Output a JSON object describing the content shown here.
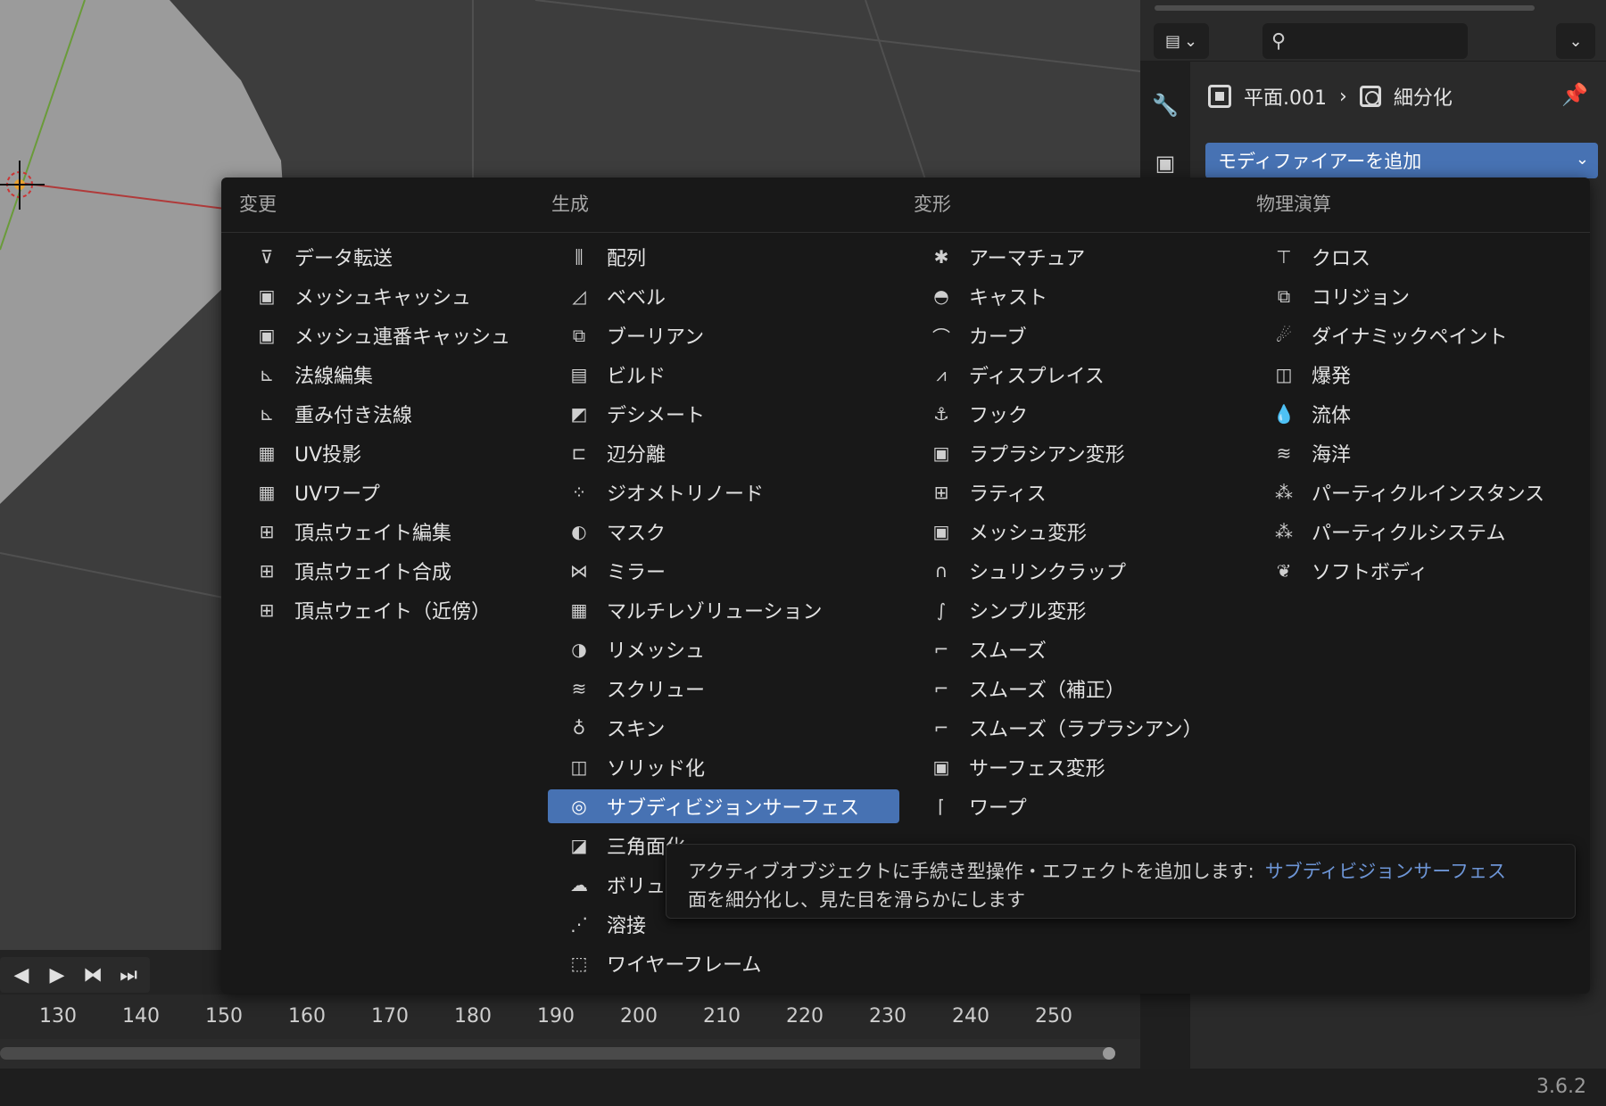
{
  "props": {
    "breadcrumb": {
      "object": "平面.001",
      "modifier": "細分化"
    },
    "add_modifier": "モディファイアーを追加",
    "search": {
      "placeholder": "",
      "icon": "search-icon"
    }
  },
  "menu": {
    "columns": [
      {
        "header": "変更",
        "items": [
          {
            "label": "データ転送",
            "icon": "data-transfer-icon",
            "glyph": "⊽"
          },
          {
            "label": "メッシュキャッシュ",
            "icon": "mesh-cache-icon",
            "glyph": "▣"
          },
          {
            "label": "メッシュ連番キャッシュ",
            "icon": "mesh-sequence-cache-icon",
            "glyph": "▣"
          },
          {
            "label": "法線編集",
            "icon": "normal-edit-icon",
            "glyph": "⊾"
          },
          {
            "label": "重み付き法線",
            "icon": "weighted-normal-icon",
            "glyph": "⊾"
          },
          {
            "label": "UV投影",
            "icon": "uv-project-icon",
            "glyph": "▦"
          },
          {
            "label": "UVワープ",
            "icon": "uv-warp-icon",
            "glyph": "▦"
          },
          {
            "label": "頂点ウェイト編集",
            "icon": "vertex-weight-edit-icon",
            "glyph": "⊞"
          },
          {
            "label": "頂点ウェイト合成",
            "icon": "vertex-weight-mix-icon",
            "glyph": "⊞"
          },
          {
            "label": "頂点ウェイト（近傍）",
            "icon": "vertex-weight-proximity-icon",
            "glyph": "⊞"
          }
        ]
      },
      {
        "header": "生成",
        "items": [
          {
            "label": "配列",
            "icon": "array-icon",
            "glyph": "⫼"
          },
          {
            "label": "ベベル",
            "icon": "bevel-icon",
            "glyph": "◿"
          },
          {
            "label": "ブーリアン",
            "icon": "boolean-icon",
            "glyph": "⧉"
          },
          {
            "label": "ビルド",
            "icon": "build-icon",
            "glyph": "▤"
          },
          {
            "label": "デシメート",
            "icon": "decimate-icon",
            "glyph": "◩"
          },
          {
            "label": "辺分離",
            "icon": "edge-split-icon",
            "glyph": "⊏"
          },
          {
            "label": "ジオメトリノード",
            "icon": "geometry-nodes-icon",
            "glyph": "⁘"
          },
          {
            "label": "マスク",
            "icon": "mask-icon",
            "glyph": "◐"
          },
          {
            "label": "ミラー",
            "icon": "mirror-icon",
            "glyph": "⋈"
          },
          {
            "label": "マルチレゾリューション",
            "icon": "multiresolution-icon",
            "glyph": "▦"
          },
          {
            "label": "リメッシュ",
            "icon": "remesh-icon",
            "glyph": "◑"
          },
          {
            "label": "スクリュー",
            "icon": "screw-icon",
            "glyph": "≋"
          },
          {
            "label": "スキン",
            "icon": "skin-icon",
            "glyph": "♁"
          },
          {
            "label": "ソリッド化",
            "icon": "solidify-icon",
            "glyph": "◫"
          },
          {
            "label": "サブディビジョンサーフェス",
            "icon": "subdivision-surface-icon",
            "glyph": "◎",
            "selected": true
          },
          {
            "label": "三角面化",
            "icon": "triangulate-icon",
            "glyph": "◪"
          },
          {
            "label": "ボリューム",
            "icon": "volume-icon",
            "glyph": "☁"
          },
          {
            "label": "溶接",
            "icon": "weld-icon",
            "glyph": "⋰"
          },
          {
            "label": "ワイヤーフレーム",
            "icon": "wireframe-icon",
            "glyph": "⬚"
          }
        ]
      },
      {
        "header": "変形",
        "items": [
          {
            "label": "アーマチュア",
            "icon": "armature-icon",
            "glyph": "✱"
          },
          {
            "label": "キャスト",
            "icon": "cast-icon",
            "glyph": "◓"
          },
          {
            "label": "カーブ",
            "icon": "curve-icon",
            "glyph": "⌒"
          },
          {
            "label": "ディスプレイス",
            "icon": "displace-icon",
            "glyph": "⩘"
          },
          {
            "label": "フック",
            "icon": "hook-icon",
            "glyph": "⚓"
          },
          {
            "label": "ラプラシアン変形",
            "icon": "laplacian-deform-icon",
            "glyph": "▣"
          },
          {
            "label": "ラティス",
            "icon": "lattice-icon",
            "glyph": "⊞"
          },
          {
            "label": "メッシュ変形",
            "icon": "mesh-deform-icon",
            "glyph": "▣"
          },
          {
            "label": "シュリンクラップ",
            "icon": "shrinkwrap-icon",
            "glyph": "∩"
          },
          {
            "label": "シンプル変形",
            "icon": "simple-deform-icon",
            "glyph": "∫"
          },
          {
            "label": "スムーズ",
            "icon": "smooth-icon",
            "glyph": "⌐"
          },
          {
            "label": "スムーズ（補正）",
            "icon": "smooth-corrective-icon",
            "glyph": "⌐"
          },
          {
            "label": "スムーズ（ラプラシアン）",
            "icon": "smooth-laplacian-icon",
            "glyph": "⌐"
          },
          {
            "label": "サーフェス変形",
            "icon": "surface-deform-icon",
            "glyph": "▣"
          },
          {
            "label": "ワープ",
            "icon": "warp-icon",
            "glyph": "⌈"
          }
        ]
      },
      {
        "header": "物理演算",
        "items": [
          {
            "label": "クロス",
            "icon": "cloth-icon",
            "glyph": "⊤"
          },
          {
            "label": "コリジョン",
            "icon": "collision-icon",
            "glyph": "⧉"
          },
          {
            "label": "ダイナミックペイント",
            "icon": "dynamic-paint-icon",
            "glyph": "☄"
          },
          {
            "label": "爆発",
            "icon": "explode-icon",
            "glyph": "◫"
          },
          {
            "label": "流体",
            "icon": "fluid-icon",
            "glyph": "💧"
          },
          {
            "label": "海洋",
            "icon": "ocean-icon",
            "glyph": "≋"
          },
          {
            "label": "パーティクルインスタンス",
            "icon": "particle-instance-icon",
            "glyph": "⁂"
          },
          {
            "label": "パーティクルシステム",
            "icon": "particle-system-icon",
            "glyph": "⁂"
          },
          {
            "label": "ソフトボディ",
            "icon": "soft-body-icon",
            "glyph": "❦"
          }
        ]
      }
    ]
  },
  "tooltip": {
    "text": "アクティブオブジェクトに手続き型操作・エフェクトを追加します:",
    "highlight": "サブディビジョンサーフェス",
    "description": "面を細分化し、見た目を滑らかにします"
  },
  "timeline": {
    "frames": [
      "130",
      "140",
      "150",
      "160",
      "170",
      "180",
      "190",
      "200",
      "210",
      "220",
      "230",
      "240",
      "250"
    ]
  },
  "version": "3.6.2",
  "colors": {
    "accent": "#4772b3",
    "menu_bg": "#181818",
    "tooltip_link": "#6d95d6"
  }
}
